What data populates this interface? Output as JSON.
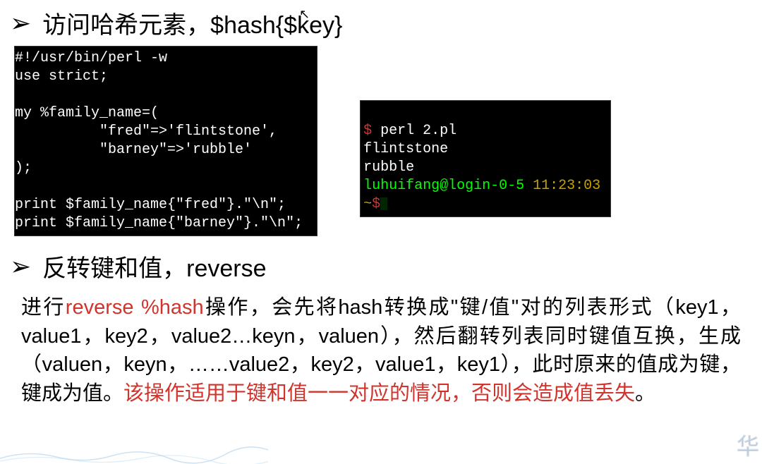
{
  "section1": {
    "title": "访问哈希元素，$hash{$key}",
    "bullet": "➢"
  },
  "code_left": {
    "line1": {
      "text": "#!/usr/bin/perl -w"
    },
    "line2": {
      "text": "use strict;"
    },
    "line3": {
      "text": ""
    },
    "line4": {
      "text": "my %family_name=("
    },
    "line5": {
      "text": "          \"fred\"=>'flintstone',"
    },
    "line6": {
      "text": "          \"barney\"=>'rubble'"
    },
    "line7": {
      "text": ");"
    },
    "line8": {
      "text": ""
    },
    "line9": {
      "text": "print $family_name{\"fred\"}.\"\\n\";"
    },
    "line10": {
      "text": "print $family_name{\"barney\"}.\"\\n\";"
    }
  },
  "code_right": {
    "line0_a": " ",
    "line1_a": "$",
    "line1_b": " perl 2.pl",
    "line2": "flintstone",
    "line3": "rubble",
    "line4_a": "luhuifang@login-0-5 ",
    "line4_b": "11:23:03",
    "line5_a": "~",
    "line5_b": "$"
  },
  "section2": {
    "title": "反转键和值，reverse",
    "bullet": "➢"
  },
  "paragraph": {
    "p1": "进行",
    "p2": "reverse %hash",
    "p3": "操作，会先将hash转换成\"键/值\"对的列表形式（key1，value1，key2，value2…keyn，valuen），然后翻转列表同时键值互换，生成（valuen，keyn，……value2，key2，value1，key1），此时原来的值成为键，键成为值。",
    "p4": "该操作适用于键和值一一对应的情况，否则会造成值丢失",
    "p5": "。"
  },
  "decorations": {
    "cursor": "↖",
    "corner": "华"
  }
}
